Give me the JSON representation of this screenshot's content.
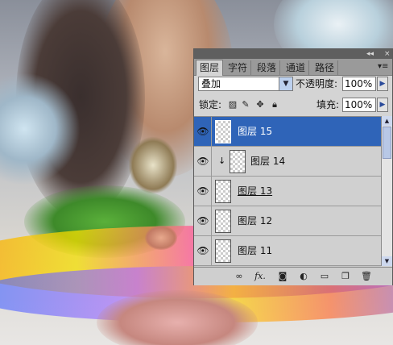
{
  "panel": {
    "tabs": [
      {
        "label": "图层",
        "active": true
      },
      {
        "label": "字符",
        "active": false
      },
      {
        "label": "段落",
        "active": false
      },
      {
        "label": "通道",
        "active": false
      },
      {
        "label": "路径",
        "active": false
      }
    ],
    "menu_icon": "panel-menu-icon",
    "blend_mode": "叠加",
    "opacity_label": "不透明度:",
    "opacity_value": "100%",
    "lock_label": "锁定:",
    "fill_label": "填充:",
    "fill_value": "100%",
    "lock_icons": [
      "lock-transparency-icon",
      "lock-paint-icon",
      "lock-move-icon",
      "lock-all-icon"
    ],
    "layers": [
      {
        "name": "图层 15",
        "selected": true,
        "clipped": false,
        "underline": false
      },
      {
        "name": "图层 14",
        "selected": false,
        "clipped": true,
        "underline": false
      },
      {
        "name": "图层 13",
        "selected": false,
        "clipped": false,
        "underline": true
      },
      {
        "name": "图层 12",
        "selected": false,
        "clipped": false,
        "underline": false
      },
      {
        "name": "图层 11",
        "selected": false,
        "clipped": false,
        "underline": false
      }
    ],
    "bottom_icons": [
      "link-layers-icon",
      "fx-icon",
      "add-mask-icon",
      "adjustment-layer-icon",
      "new-group-icon",
      "new-layer-icon",
      "trash-icon"
    ],
    "selection_color": "#2f64b8"
  }
}
